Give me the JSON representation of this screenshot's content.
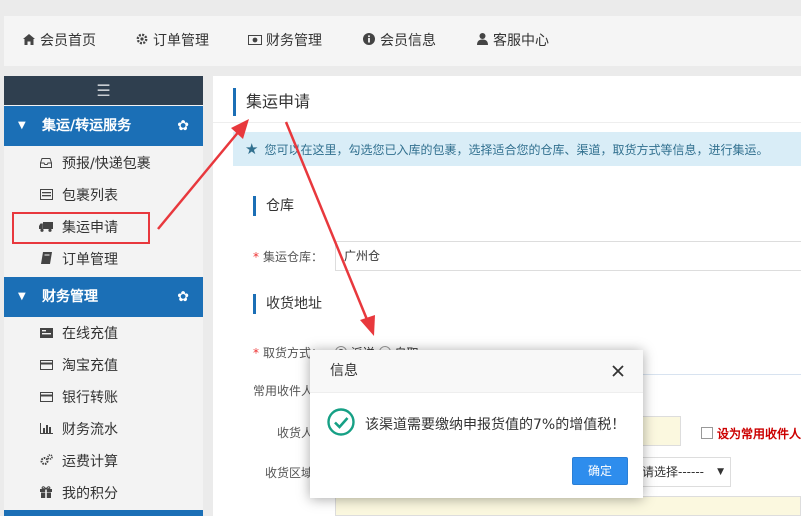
{
  "topnav": {
    "items": [
      {
        "label": "会员首页",
        "icon": "home-icon"
      },
      {
        "label": "订单管理",
        "icon": "gear-icon"
      },
      {
        "label": "财务管理",
        "icon": "money-icon"
      },
      {
        "label": "会员信息",
        "icon": "info-icon"
      },
      {
        "label": "客服中心",
        "icon": "user-icon"
      }
    ]
  },
  "sidebar": {
    "toggle": "☰",
    "groups": [
      {
        "label": "集运/转运服务",
        "items": [
          {
            "label": "预报/快递包裹",
            "icon": "inbox-icon"
          },
          {
            "label": "包裹列表",
            "icon": "list-icon"
          },
          {
            "label": "集运申请",
            "icon": "truck-icon"
          },
          {
            "label": "订单管理",
            "icon": "book-icon"
          }
        ]
      },
      {
        "label": "财务管理",
        "items": [
          {
            "label": "在线充值",
            "icon": "money-icon"
          },
          {
            "label": "淘宝充值",
            "icon": "card-icon"
          },
          {
            "label": "银行转账",
            "icon": "card-icon"
          },
          {
            "label": "财务流水",
            "icon": "bar-chart-icon"
          },
          {
            "label": "运费计算",
            "icon": "cogs-icon"
          },
          {
            "label": "我的积分",
            "icon": "gift-icon"
          }
        ]
      }
    ]
  },
  "main": {
    "title": "集运申请",
    "notice": "您可以在这里，勾选您已入库的包裹，选择适合您的仓库、渠道，取货方式等信息，进行集运。",
    "sections": {
      "warehouse": "仓库",
      "address": "收货地址"
    },
    "warehouse_label": "集运仓库：",
    "warehouse_value": "广州仓",
    "pickup_label": "取货方式：",
    "pickup_option1": "派送",
    "pickup_option2": "自取",
    "common_receiver_label": "常用收件人",
    "receiver_label": "收货人",
    "region_label": "收货区域",
    "region_select": "请选择------",
    "set_common_label": "设为常用收件人"
  },
  "dialog": {
    "title": "信息",
    "message": "该渠道需要缴纳申报货值的7%的增值税！",
    "ok_label": "确定"
  },
  "colors": {
    "accent": "#1b6fb6",
    "highlight": "#e8383d",
    "success": "#16a085",
    "button": "#2e8ded"
  }
}
